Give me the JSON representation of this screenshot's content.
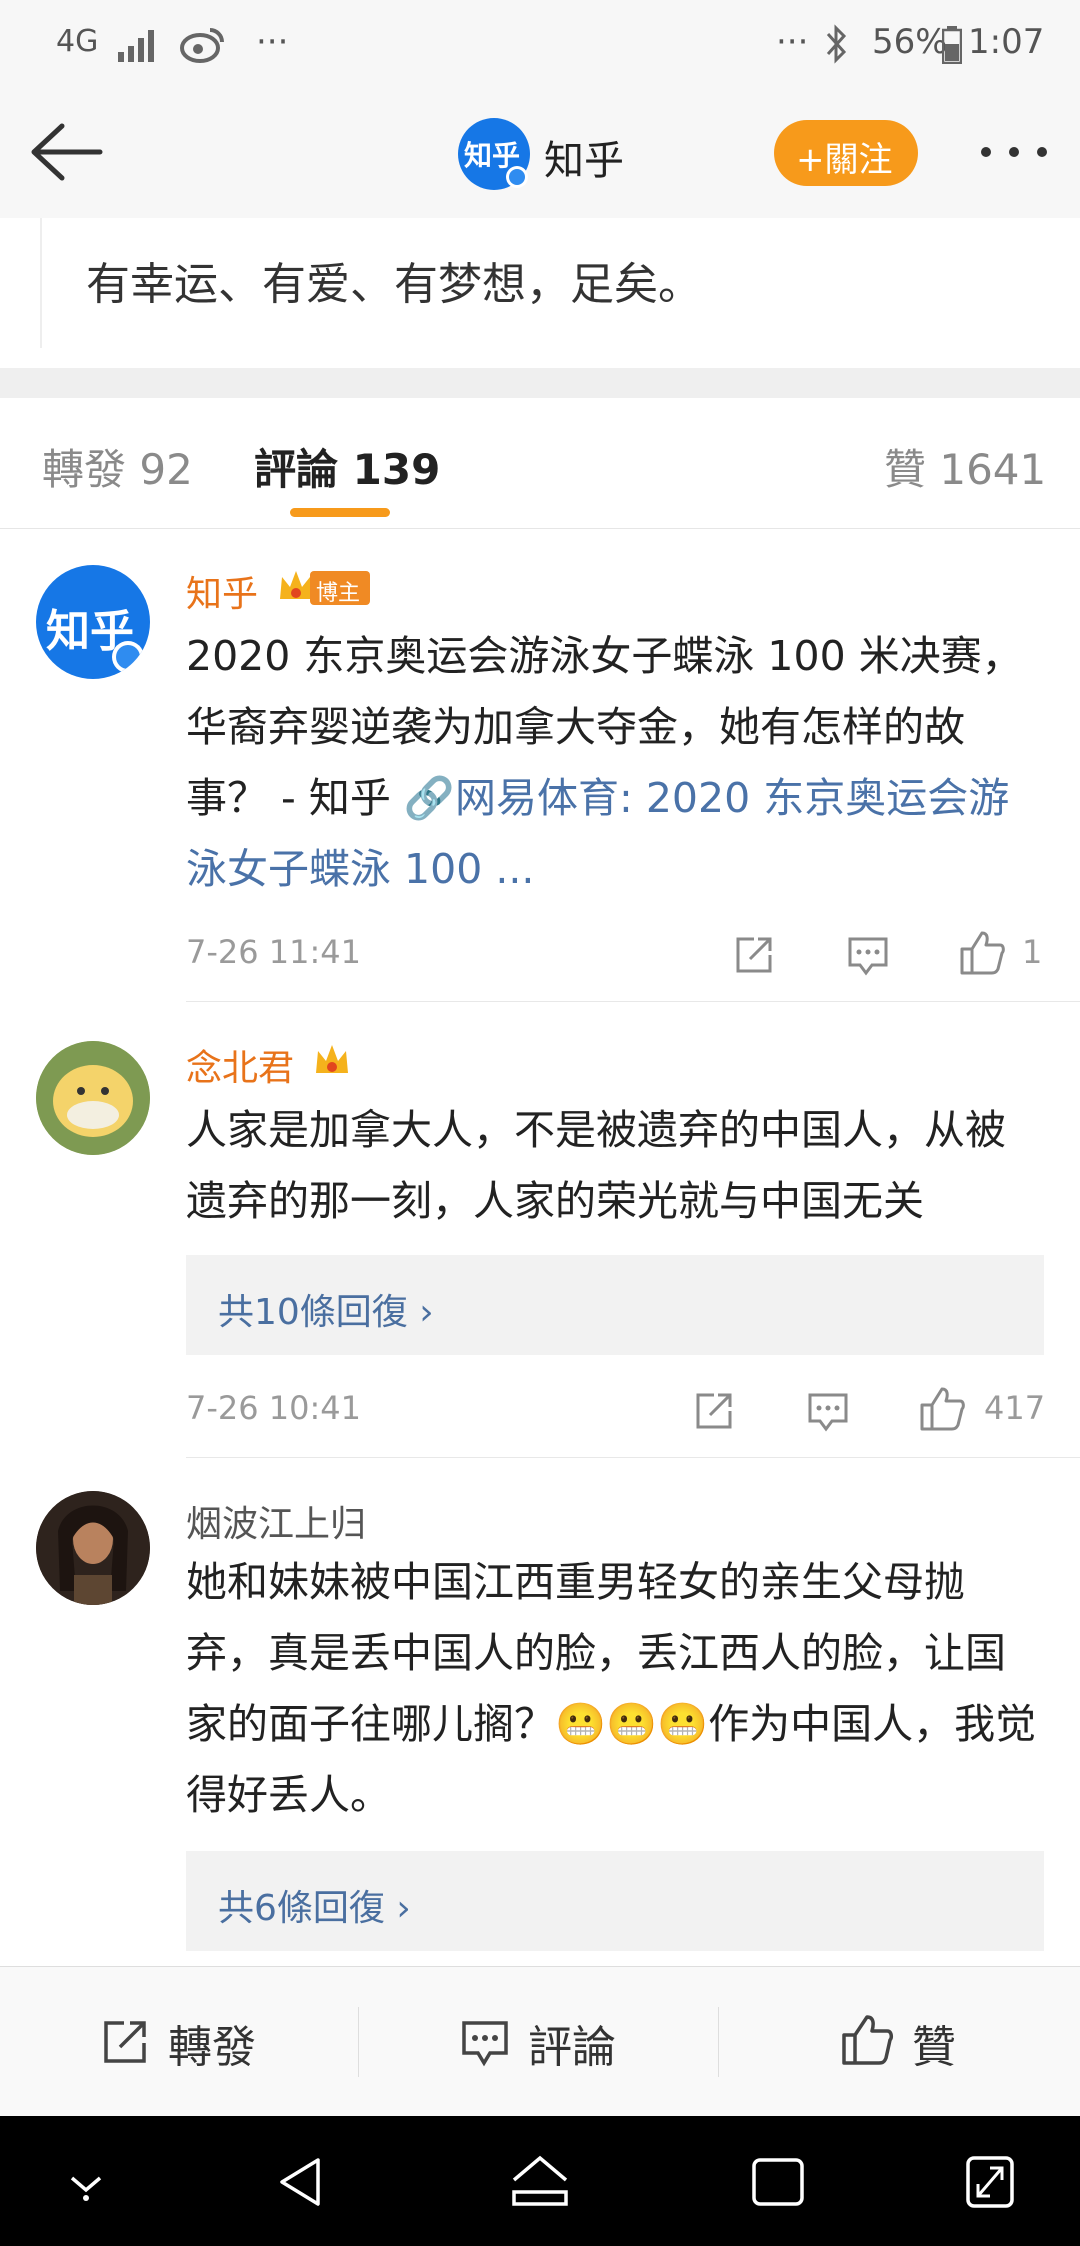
{
  "status_bar": {
    "network": "4G",
    "battery_percent": "56%",
    "time": "1:07",
    "left_dots": "···",
    "right_dots": "···"
  },
  "header": {
    "account_name": "知乎",
    "avatar_text": "知乎",
    "follow_label": "+關注"
  },
  "post": {
    "tail_text": "有幸运、有爱、有梦想，足矣。"
  },
  "tabs": {
    "repost": "轉發 92",
    "comments": "評論 139",
    "likes": "贊 1641"
  },
  "comments": [
    {
      "name": "知乎",
      "badge": "博主",
      "avatar_text": "知乎",
      "text_plain": "2020 东京奥运会游泳女子蝶泳 100 米决赛，华裔弃婴逆袭为加拿大夺金，她有怎样的故事？ - 知乎 ",
      "link_text": "网易体育: 2020 东京奥运会游泳女子蝶泳 100 ...",
      "date": "7-26 11:41",
      "likes": "1"
    },
    {
      "name": "念北君",
      "text": "人家是加拿大人，不是被遗弃的中国人，从被遗弃的那一刻，人家的荣光就与中国无关",
      "replies": "共10條回復 ›",
      "date": "7-26 10:41",
      "likes": "417"
    },
    {
      "name": "烟波江上归",
      "text_before": "她和妹妹被中国江西重男轻女的亲生父母抛弃，真是丢中国人的脸，丢江西人的脸，让国家的面子往哪儿搁？",
      "emoji": "😬😬😬",
      "text_after": "作为中国人，我觉得好丢人。",
      "replies": "共6條回復 ›"
    }
  ],
  "bottom_bar": {
    "repost": "轉發",
    "comment": "評論",
    "like": "贊"
  },
  "colors": {
    "accent_orange": "#f79a1b",
    "weibo_orange": "#e8731a",
    "link_blue": "#4a72a8",
    "zhihu_blue": "#1677e6"
  }
}
